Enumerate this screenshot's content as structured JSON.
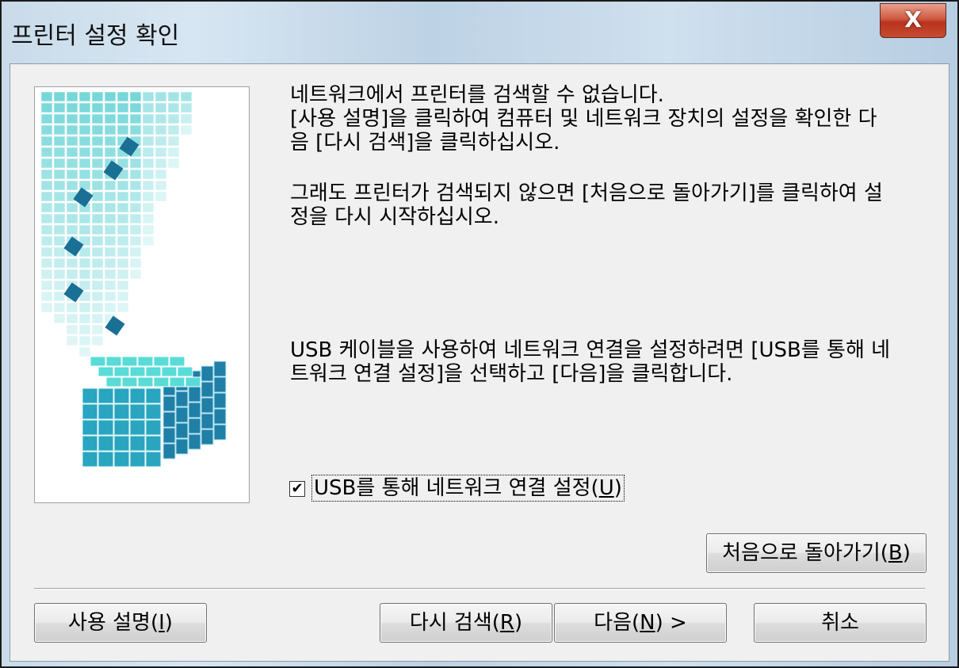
{
  "window": {
    "title": "프린터 설정 확인",
    "close_label": "X"
  },
  "message": {
    "para1": "네트워크에서 프린터를 검색할 수 없습니다.\n[사용 설명]을 클릭하여 컴퓨터 및 네트워크 장치의 설정을 확인한 다\n음 [다시 검색]을 클릭하십시오.",
    "para2": "그래도 프린터가 검색되지 않으면 [처음으로 돌아가기]를 클릭하여 설\n정을 다시 시작하십시오.",
    "para3": "USB 케이블을 사용하여 네트워크 연결을 설정하려면 [USB를 통해 네\n트워크 연결 설정]을 선택하고 [다음]을 클릭합니다."
  },
  "usb_option": {
    "label_text": "USB를 통해 네트워크 연결 설정(",
    "accel": "U",
    "suffix": ")",
    "checked": true
  },
  "buttons": {
    "back_to_start": {
      "text": "처음으로 돌아가기(",
      "accel": "B",
      "suffix": ")"
    },
    "instructions": {
      "text": "사용 설명(",
      "accel": "I",
      "suffix": ")"
    },
    "search_again": {
      "text": "다시 검색(",
      "accel": "R",
      "suffix": ")"
    },
    "next": {
      "text": "다음(",
      "accel": "N",
      "suffix": ") >"
    },
    "cancel": {
      "text": "취소"
    }
  },
  "colors": {
    "accent_cyan": "#2bb8c4",
    "close_red": "#c74a31"
  }
}
